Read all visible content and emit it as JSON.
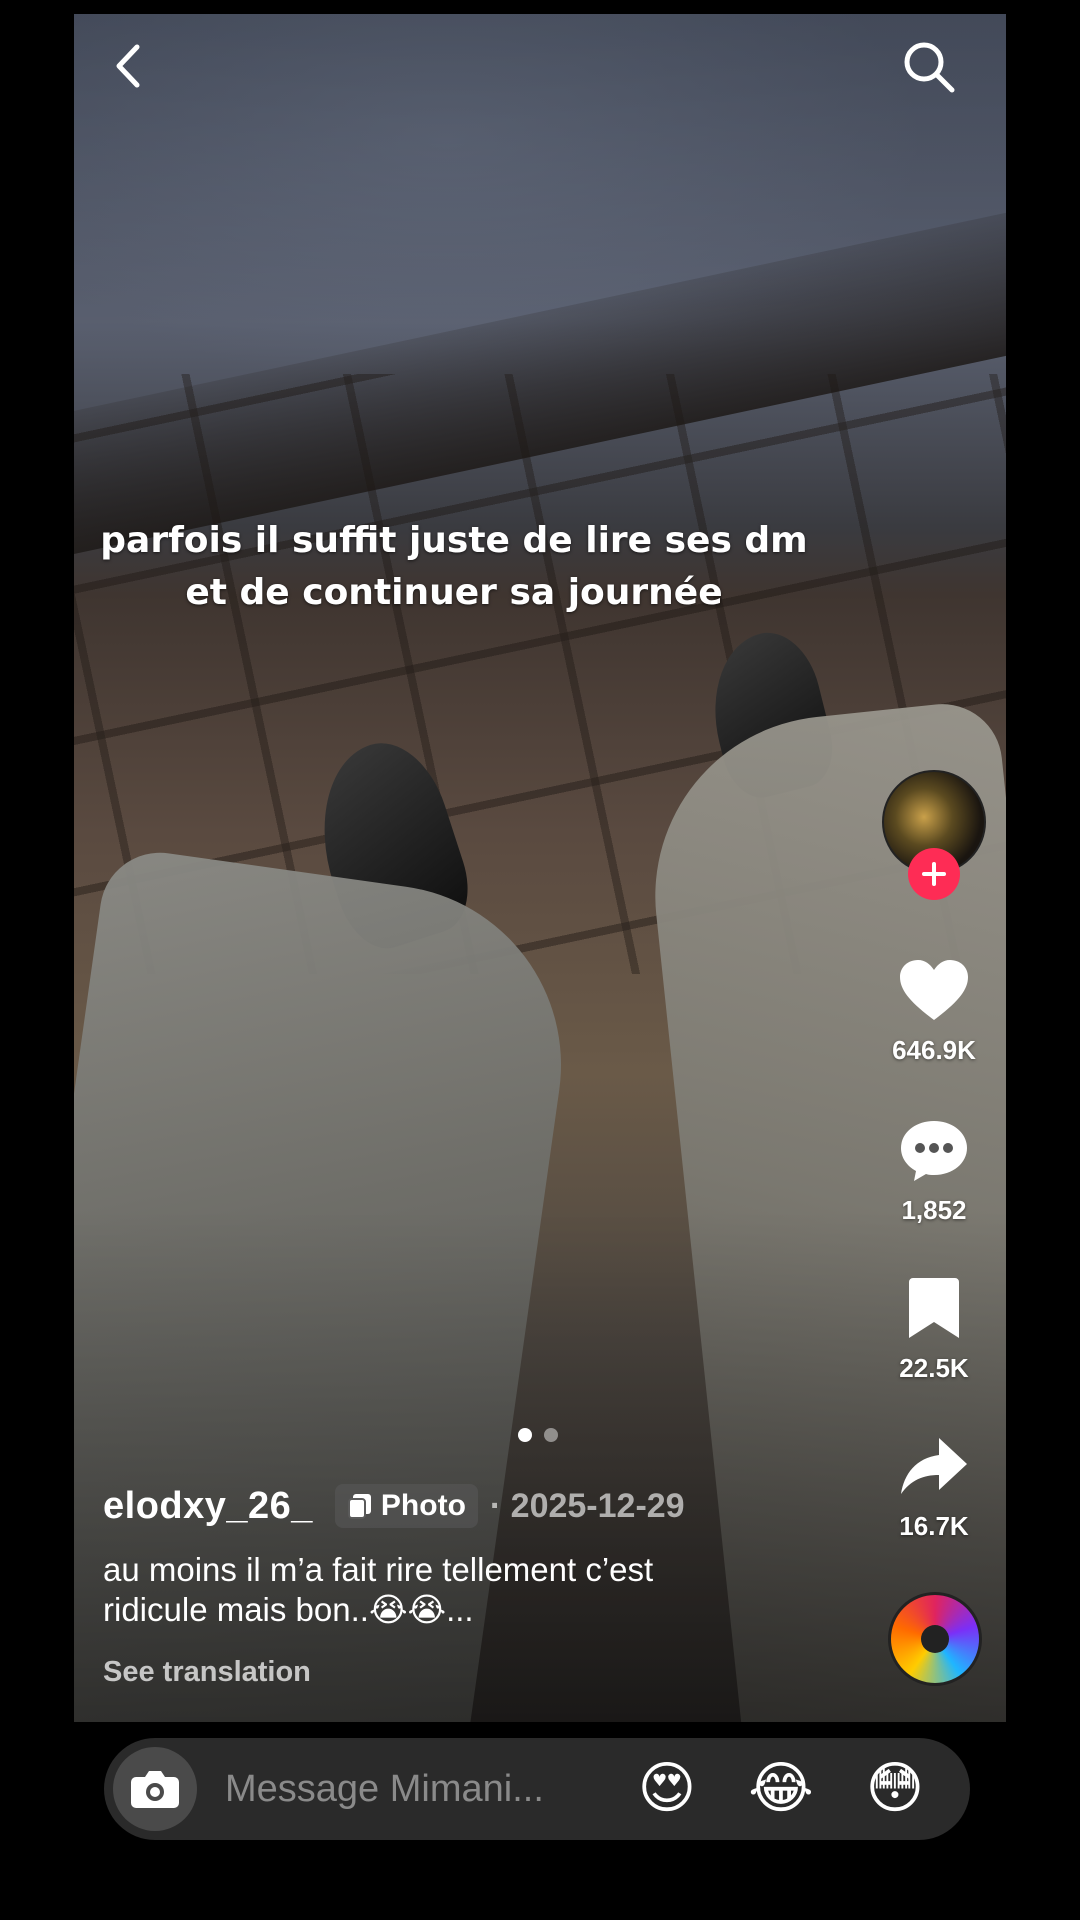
{
  "post": {
    "overlay_text": "parfois il suffit juste de lire ses dm et de continuer sa journée",
    "author": "elodxy_26_",
    "type_badge": "Photo",
    "date": "· 2025-12-29",
    "caption": "au moins il m’a fait rire tellement c’est ridicule mais bon..😭😭...",
    "see_translation": "See translation",
    "slides": {
      "count": 2,
      "active": 1
    }
  },
  "actions": {
    "likes": "646.9K",
    "comments": "1,852",
    "bookmarks": "22.5K",
    "shares": "16.7K"
  },
  "message_bar": {
    "placeholder": "Message Mimani...",
    "emojis": [
      "😍",
      "😂",
      "😳"
    ]
  },
  "icons": {
    "back": "chevron-left-icon",
    "search": "search-icon",
    "follow": "plus-icon",
    "like": "heart-icon",
    "comment": "speech-bubble-icon",
    "bookmark": "bookmark-icon",
    "share": "share-arrow-icon",
    "camera": "camera-icon"
  },
  "colors": {
    "accent": "#fe2c55",
    "message_bar": "#2a2a2a"
  }
}
